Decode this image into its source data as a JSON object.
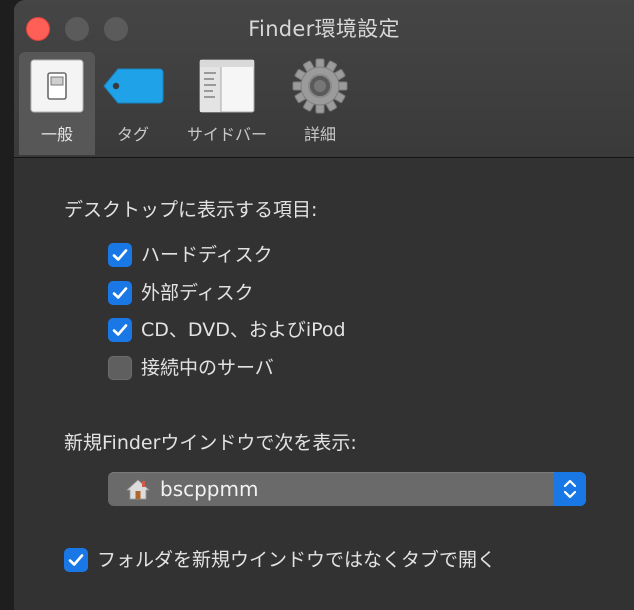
{
  "window": {
    "title": "Finder環境設定"
  },
  "tabs": [
    {
      "label": "一般",
      "icon": "general-switch-icon",
      "selected": true
    },
    {
      "label": "タグ",
      "icon": "tag-icon",
      "selected": false
    },
    {
      "label": "サイドバー",
      "icon": "sidebar-icon",
      "selected": false
    },
    {
      "label": "詳細",
      "icon": "gear-icon",
      "selected": false
    }
  ],
  "desktop_section": {
    "heading": "デスクトップに表示する項目:",
    "items": [
      {
        "label": "ハードディスク",
        "checked": true
      },
      {
        "label": "外部ディスク",
        "checked": true
      },
      {
        "label": "CD、DVD、およびiPod",
        "checked": true
      },
      {
        "label": "接続中のサーバ",
        "checked": false
      }
    ]
  },
  "new_window_section": {
    "heading": "新規Finderウインドウで次を表示:",
    "selected_value": "bscppmm",
    "icon": "home-icon"
  },
  "open_folders_in_tabs": {
    "label": "フォルダを新規ウインドウではなくタブで開く",
    "checked": true
  },
  "colors": {
    "accent": "#1a78e6",
    "close_button": "#ff5f57",
    "window_background": "#323232"
  }
}
